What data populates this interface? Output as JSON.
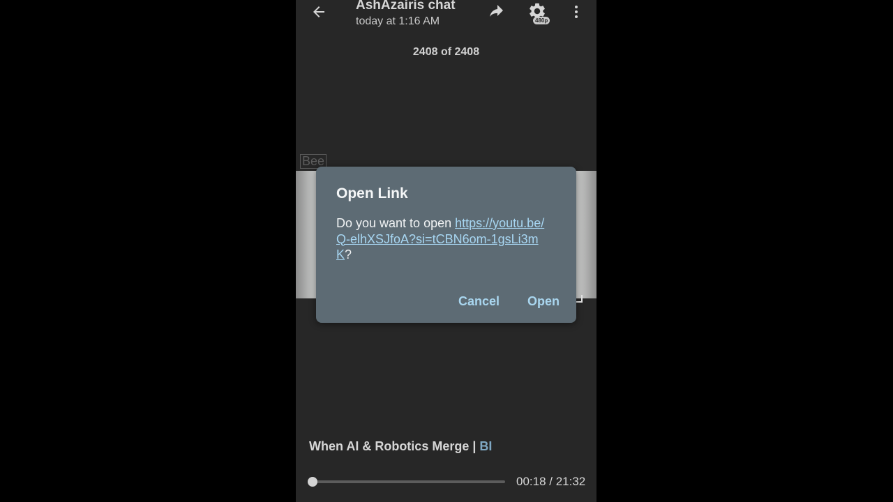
{
  "header": {
    "title": "AshAzairis chat",
    "subtitle": "today at 1:16 AM",
    "quality_badge": "480p",
    "icons": {
      "back": "arrow-left-icon",
      "share": "share-arrow-icon",
      "settings": "gear-icon",
      "more": "more-vertical-icon"
    }
  },
  "counter": "2408 of 2408",
  "video": {
    "watermark": "Bee"
  },
  "dialog": {
    "title": "Open Link",
    "message_prefix": "Do you want to open ",
    "link": "https://youtu.be/Q-elhXSJfoA?si=tCBN6om-1gsLi3mK",
    "message_suffix": "?",
    "cancel_label": "Cancel",
    "open_label": "Open"
  },
  "media": {
    "title": "When AI & Robotics Merge",
    "title_separator": " | ",
    "title_source": "BI",
    "current_time": "00:18",
    "duration": "21:32",
    "time_separator": " / ",
    "progress": 0.014
  },
  "colors": {
    "background": "#000000",
    "panel": "#272727",
    "dialog": "#5d6b74",
    "accent": "#a9d6ef",
    "link": "#a7d6f2"
  }
}
